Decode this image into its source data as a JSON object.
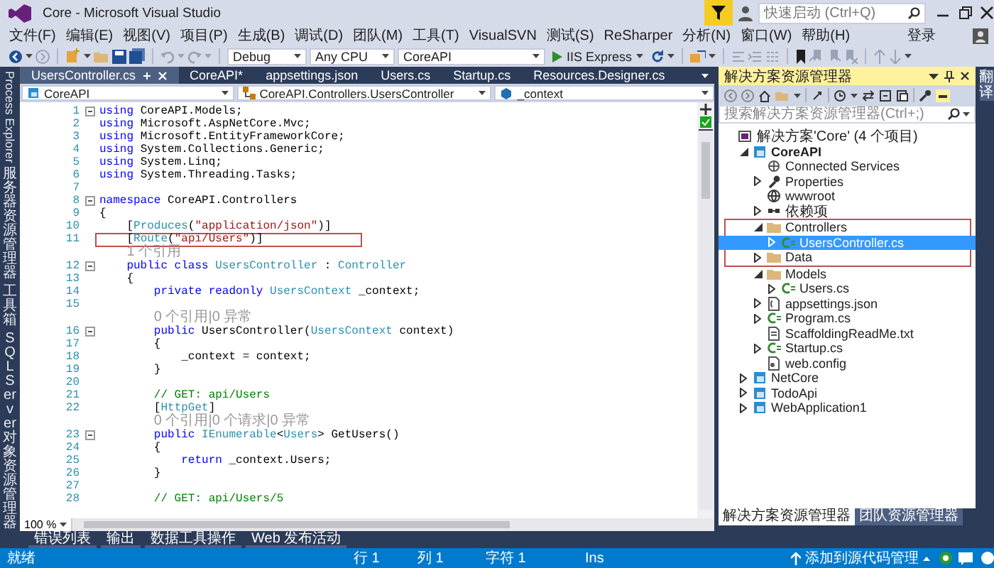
{
  "window": {
    "title": "Core - Microsoft Visual Studio",
    "quick_launch": {
      "placeholder": "快速启动 (Ctrl+Q)"
    },
    "sign_in": "登录"
  },
  "menu": [
    "文件(F)",
    "编辑(E)",
    "视图(V)",
    "项目(P)",
    "生成(B)",
    "调试(D)",
    "团队(M)",
    "工具(T)",
    "VisualSVN",
    "测试(S)",
    "ReSharper",
    "分析(N)",
    "窗口(W)",
    "帮助(H)"
  ],
  "toolbar": {
    "configuration": "Debug",
    "platform": "Any CPU",
    "startup_project": "CoreAPI",
    "run": "IIS Express"
  },
  "left_strip": [
    {
      "label": "Process Explorer",
      "kind": "rotated"
    },
    {
      "label": "服务器资源管理器",
      "kind": "stacked"
    },
    {
      "label": "工具箱",
      "kind": "stacked"
    },
    {
      "label": "SQL Server 对象资源管理器",
      "kind": "stacked"
    }
  ],
  "editor": {
    "tabs": [
      {
        "label": "UsersController.cs",
        "selected": true
      },
      {
        "label": "CoreAPI*",
        "selected": false
      },
      {
        "label": "appsettings.json",
        "selected": false
      },
      {
        "label": "Users.cs",
        "selected": false
      },
      {
        "label": "Startup.cs",
        "selected": false
      },
      {
        "label": "Resources.Designer.cs",
        "selected": false
      }
    ],
    "nav": [
      "CoreAPI",
      "CoreAPI.Controllers.UsersController",
      "_context"
    ],
    "lines": [
      {
        "kind": "code",
        "number": "1",
        "foldable": true,
        "highlighted": false,
        "tokens": [
          {
            "kind": "kw",
            "text": "using"
          },
          {
            "kind": "txt",
            "text": " CoreAPI.Models;"
          }
        ]
      },
      {
        "kind": "code",
        "number": "2",
        "foldable": false,
        "highlighted": false,
        "tokens": [
          {
            "kind": "kw",
            "text": "using"
          },
          {
            "kind": "txt",
            "text": " Microsoft.AspNetCore.Mvc;"
          }
        ]
      },
      {
        "kind": "code",
        "number": "3",
        "foldable": false,
        "highlighted": false,
        "tokens": [
          {
            "kind": "kw",
            "text": "using"
          },
          {
            "kind": "txt",
            "text": " Microsoft.EntityFrameworkCore;"
          }
        ]
      },
      {
        "kind": "code",
        "number": "4",
        "foldable": false,
        "highlighted": false,
        "tokens": [
          {
            "kind": "kw",
            "text": "using"
          },
          {
            "kind": "txt",
            "text": " System.Collections.Generic;"
          }
        ]
      },
      {
        "kind": "code",
        "number": "5",
        "foldable": false,
        "highlighted": false,
        "tokens": [
          {
            "kind": "kw",
            "text": "using"
          },
          {
            "kind": "txt",
            "text": " System.Linq;"
          }
        ]
      },
      {
        "kind": "code",
        "number": "6",
        "foldable": false,
        "highlighted": false,
        "tokens": [
          {
            "kind": "kw",
            "text": "using"
          },
          {
            "kind": "txt",
            "text": " System.Threading.Tasks;"
          }
        ]
      },
      {
        "kind": "code",
        "number": "7",
        "foldable": false,
        "highlighted": false
      },
      {
        "kind": "code",
        "number": "8",
        "foldable": true,
        "highlighted": false,
        "tokens": [
          {
            "kind": "kw",
            "text": "namespace"
          },
          {
            "kind": "txt",
            "text": " CoreAPI.Controllers"
          }
        ]
      },
      {
        "kind": "code",
        "number": "9",
        "foldable": false,
        "highlighted": false,
        "tokens": [
          {
            "kind": "txt",
            "text": "{"
          }
        ]
      },
      {
        "kind": "code",
        "number": "10",
        "foldable": false,
        "highlighted": false,
        "tokens": [
          {
            "kind": "txt",
            "text": "    ["
          },
          {
            "kind": "type",
            "text": "Produces"
          },
          {
            "kind": "txt",
            "text": "("
          },
          {
            "kind": "str",
            "text": "\"application/json\""
          },
          {
            "kind": "txt",
            "text": ")]"
          }
        ]
      },
      {
        "kind": "code",
        "number": "11",
        "foldable": false,
        "highlighted": true,
        "tokens": [
          {
            "kind": "txt",
            "text": "    ["
          },
          {
            "kind": "type",
            "text": "Route"
          },
          {
            "kind": "txt",
            "text": "("
          },
          {
            "kind": "str",
            "text": "\"api/Users\""
          },
          {
            "kind": "txt",
            "text": ")]"
          }
        ]
      },
      {
        "kind": "hint",
        "text": "1 个引用"
      },
      {
        "kind": "code",
        "number": "12",
        "foldable": true,
        "highlighted": false,
        "tokens": [
          {
            "kind": "kw",
            "text": "    public class"
          },
          {
            "kind": "type",
            "text": " UsersController"
          },
          {
            "kind": "txt",
            "text": " : "
          },
          {
            "kind": "type",
            "text": "Controller"
          }
        ]
      },
      {
        "kind": "code",
        "number": "13",
        "foldable": false,
        "highlighted": false,
        "tokens": [
          {
            "kind": "txt",
            "text": "    {"
          }
        ]
      },
      {
        "kind": "code",
        "number": "14",
        "foldable": false,
        "highlighted": false,
        "tokens": [
          {
            "kind": "kw",
            "text": "        private readonly"
          },
          {
            "kind": "type",
            "text": " UsersContext"
          },
          {
            "kind": "txt",
            "text": " _context;"
          }
        ]
      },
      {
        "kind": "code",
        "number": "15",
        "foldable": false,
        "highlighted": false
      },
      {
        "kind": "hint",
        "text": "0 个引用|0 异常"
      },
      {
        "kind": "code",
        "number": "16",
        "foldable": true,
        "highlighted": false,
        "tokens": [
          {
            "kind": "kw",
            "text": "        public"
          },
          {
            "kind": "txt",
            "text": " UsersController("
          },
          {
            "kind": "type",
            "text": "UsersContext"
          },
          {
            "kind": "txt",
            "text": " context)"
          }
        ]
      },
      {
        "kind": "code",
        "number": "17",
        "foldable": false,
        "highlighted": false,
        "tokens": [
          {
            "kind": "txt",
            "text": "        {"
          }
        ]
      },
      {
        "kind": "code",
        "number": "18",
        "foldable": false,
        "highlighted": false,
        "tokens": [
          {
            "kind": "txt",
            "text": "            _context = context;"
          }
        ]
      },
      {
        "kind": "code",
        "number": "19",
        "foldable": false,
        "highlighted": false,
        "tokens": [
          {
            "kind": "txt",
            "text": "        }"
          }
        ]
      },
      {
        "kind": "code",
        "number": "20",
        "foldable": false,
        "highlighted": false
      },
      {
        "kind": "code",
        "number": "21",
        "foldable": false,
        "highlighted": false,
        "tokens": [
          {
            "kind": "cm",
            "text": "        // GET: api/Users"
          }
        ]
      },
      {
        "kind": "code",
        "number": "22",
        "foldable": false,
        "highlighted": false,
        "tokens": [
          {
            "kind": "txt",
            "text": "        ["
          },
          {
            "kind": "type",
            "text": "HttpGet"
          },
          {
            "kind": "txt",
            "text": "]"
          }
        ]
      },
      {
        "kind": "hint",
        "text": "0 个引用|0 个请求|0 异常"
      },
      {
        "kind": "code",
        "number": "23",
        "foldable": true,
        "highlighted": false,
        "tokens": [
          {
            "kind": "kw",
            "text": "        public"
          },
          {
            "kind": "type",
            "text": " IEnumerable"
          },
          {
            "kind": "txt",
            "text": "<"
          },
          {
            "kind": "type",
            "text": "Users"
          },
          {
            "kind": "txt",
            "text": "> GetUsers()"
          }
        ]
      },
      {
        "kind": "code",
        "number": "24",
        "foldable": false,
        "highlighted": false,
        "tokens": [
          {
            "kind": "txt",
            "text": "        {"
          }
        ]
      },
      {
        "kind": "code",
        "number": "25",
        "foldable": false,
        "highlighted": false,
        "tokens": [
          {
            "kind": "kw",
            "text": "            return"
          },
          {
            "kind": "txt",
            "text": " _context.Users;"
          }
        ]
      },
      {
        "kind": "code",
        "number": "26",
        "foldable": false,
        "highlighted": false,
        "tokens": [
          {
            "kind": "txt",
            "text": "        }"
          }
        ]
      },
      {
        "kind": "code",
        "number": "27",
        "foldable": false,
        "highlighted": false
      },
      {
        "kind": "code",
        "number": "28",
        "foldable": false,
        "highlighted": false,
        "tokens": [
          {
            "kind": "cm",
            "text": "        // GET: api/Users/5"
          }
        ]
      }
    ],
    "zoom": "100 %"
  },
  "output_tabs": [
    "错误列表",
    "输出",
    "数据工具操作",
    "Web 发布活动"
  ],
  "solution_explorer": {
    "title": "解决方案资源管理器",
    "search": {
      "placeholder": "搜索解决方案资源管理器(Ctrl+;)"
    },
    "tree": [
      {
        "label": "解决方案'Core' (4 个项目)",
        "kind": "solution",
        "selected": false,
        "highlighted": false,
        "children": [
          {
            "label": "CoreAPI",
            "kind": "project",
            "startup_project": true,
            "expanded": true,
            "selected": false,
            "highlighted": false,
            "children": [
              {
                "label": "Connected Services",
                "kind": "service",
                "selected": false,
                "highlighted": false
              },
              {
                "label": "Properties",
                "kind": "wrench",
                "expanded": false,
                "selected": false,
                "highlighted": false
              },
              {
                "label": "wwwroot",
                "kind": "globe",
                "selected": false,
                "highlighted": false
              },
              {
                "label": "依赖项",
                "kind": "references",
                "expanded": false,
                "selected": false,
                "highlighted": false
              },
              {
                "label": "Controllers",
                "kind": "folder",
                "expanded": true,
                "selected": false,
                "highlighted": true,
                "children": [
                  {
                    "label": "UsersController.cs",
                    "kind": "csharp",
                    "expanded": false,
                    "selected": true,
                    "highlighted": true
                  }
                ]
              },
              {
                "label": "Data",
                "kind": "folder",
                "expanded": false,
                "selected": false,
                "highlighted": true
              },
              {
                "label": "Models",
                "kind": "folder",
                "expanded": true,
                "selected": false,
                "highlighted": false,
                "children": [
                  {
                    "label": "Users.cs",
                    "kind": "csharp",
                    "expanded": false,
                    "selected": false,
                    "highlighted": false
                  }
                ]
              },
              {
                "label": "appsettings.json",
                "kind": "json",
                "expanded": false,
                "selected": false,
                "highlighted": false
              },
              {
                "label": "Program.cs",
                "kind": "csharp",
                "expanded": false,
                "selected": false,
                "highlighted": false
              },
              {
                "label": "ScaffoldingReadMe.txt",
                "kind": "text",
                "selected": false,
                "highlighted": false
              },
              {
                "label": "Startup.cs",
                "kind": "csharp",
                "expanded": false,
                "selected": false,
                "highlighted": false
              },
              {
                "label": "web.config",
                "kind": "config",
                "selected": false,
                "highlighted": false
              }
            ]
          },
          {
            "label": "NetCore",
            "kind": "project",
            "startup_project": false,
            "expanded": false,
            "selected": false,
            "highlighted": false
          },
          {
            "label": "TodoApi",
            "kind": "project",
            "startup_project": false,
            "expanded": false,
            "selected": false,
            "highlighted": false
          },
          {
            "label": "WebApplication1",
            "kind": "project",
            "startup_project": false,
            "expanded": false,
            "selected": false,
            "highlighted": false
          }
        ]
      }
    ],
    "tabs": [
      {
        "label": "解决方案资源管理器",
        "selected": true
      },
      {
        "label": "团队资源管理器",
        "selected": false
      }
    ]
  },
  "right_strip": [
    "翻译"
  ],
  "status_bar": {
    "message": "就绪",
    "line": "行 1",
    "column": "列 1",
    "char": "字符 1",
    "mode": "Ins",
    "source_control": "添加到源代码管理"
  }
}
